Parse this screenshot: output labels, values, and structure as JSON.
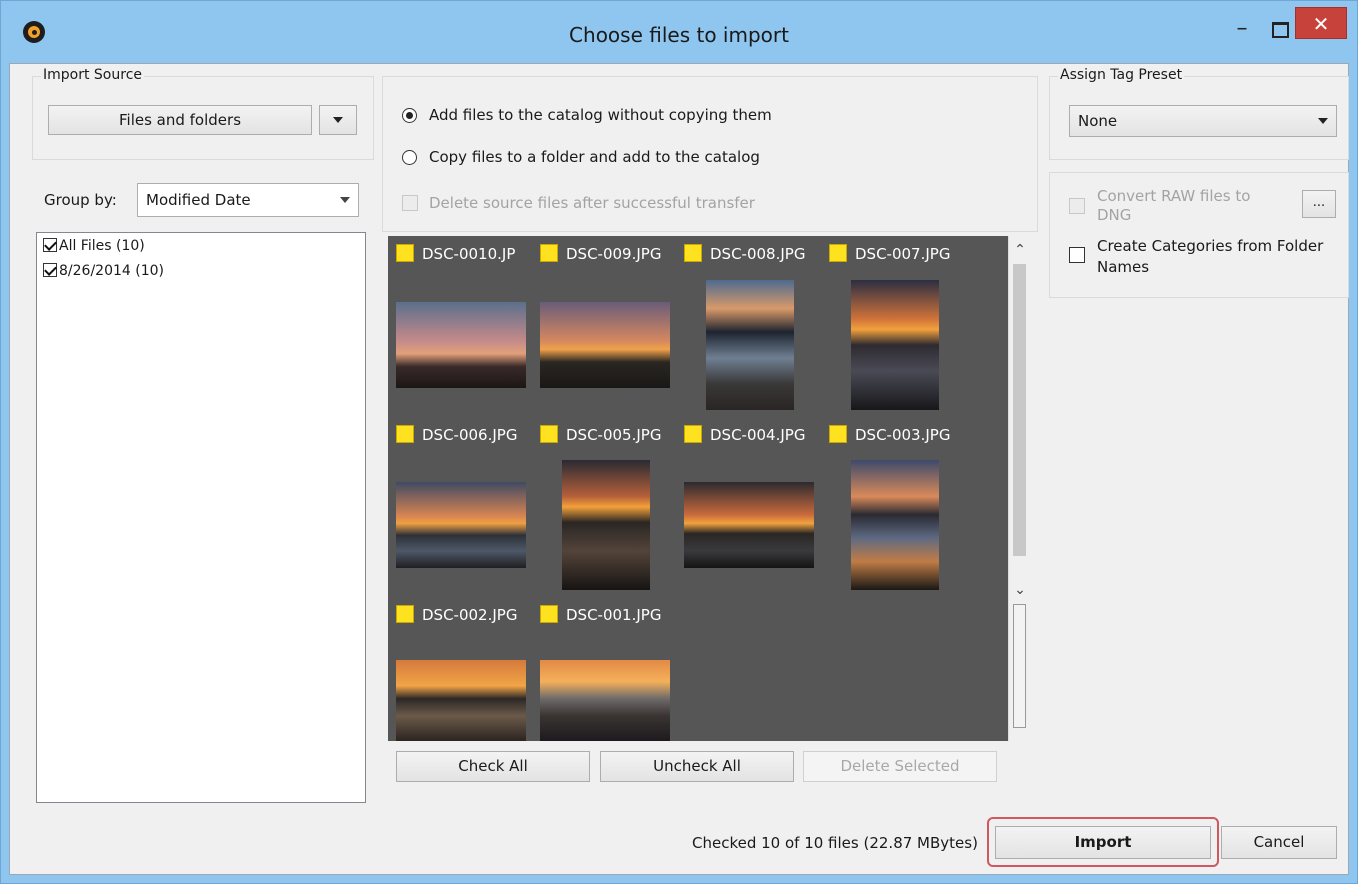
{
  "window": {
    "title": "Choose files to import",
    "minimize": "–",
    "close": "✕"
  },
  "import_source": {
    "legend": "Import Source",
    "button_label": "Files and folders"
  },
  "group_by": {
    "label": "Group by:",
    "value": "Modified Date"
  },
  "tree": {
    "items": [
      {
        "label": "All Files (10)",
        "checked": true
      },
      {
        "label": "8/26/2014 (10)",
        "checked": true
      }
    ]
  },
  "options": {
    "add_without_copy": "Add files to the catalog without copying them",
    "copy_to_folder": "Copy files to a folder and add to the catalog",
    "delete_source": "Delete source files after successful transfer",
    "selected": "add_without_copy"
  },
  "thumbnails": [
    {
      "name": "DSC-0010.JP",
      "checked": true
    },
    {
      "name": "DSC-009.JPG",
      "checked": true
    },
    {
      "name": "DSC-008.JPG",
      "checked": true
    },
    {
      "name": "DSC-007.JPG",
      "checked": true
    },
    {
      "name": "DSC-006.JPG",
      "checked": true
    },
    {
      "name": "DSC-005.JPG",
      "checked": true
    },
    {
      "name": "DSC-004.JPG",
      "checked": true
    },
    {
      "name": "DSC-003.JPG",
      "checked": true
    },
    {
      "name": "DSC-002.JPG",
      "checked": true
    },
    {
      "name": "DSC-001.JPG",
      "checked": true
    }
  ],
  "buttons": {
    "check_all": "Check All",
    "uncheck_all": "Uncheck All",
    "delete_selected": "Delete Selected",
    "import": "Import",
    "cancel": "Cancel",
    "ellipsis": "..."
  },
  "tag_preset": {
    "legend": "Assign Tag Preset",
    "value": "None"
  },
  "raw": {
    "convert_label": "Convert RAW files to DNG",
    "create_categories_label": "Create Categories from Folder Names"
  },
  "status": "Checked 10 of 10 files (22.87 MBytes)",
  "colors": {
    "titlebar": "#8fc6ef",
    "close_button": "#c7423b",
    "grid_background": "#565656",
    "checkbox_yellow": "#ffe21f",
    "import_highlight": "#d0585e"
  }
}
